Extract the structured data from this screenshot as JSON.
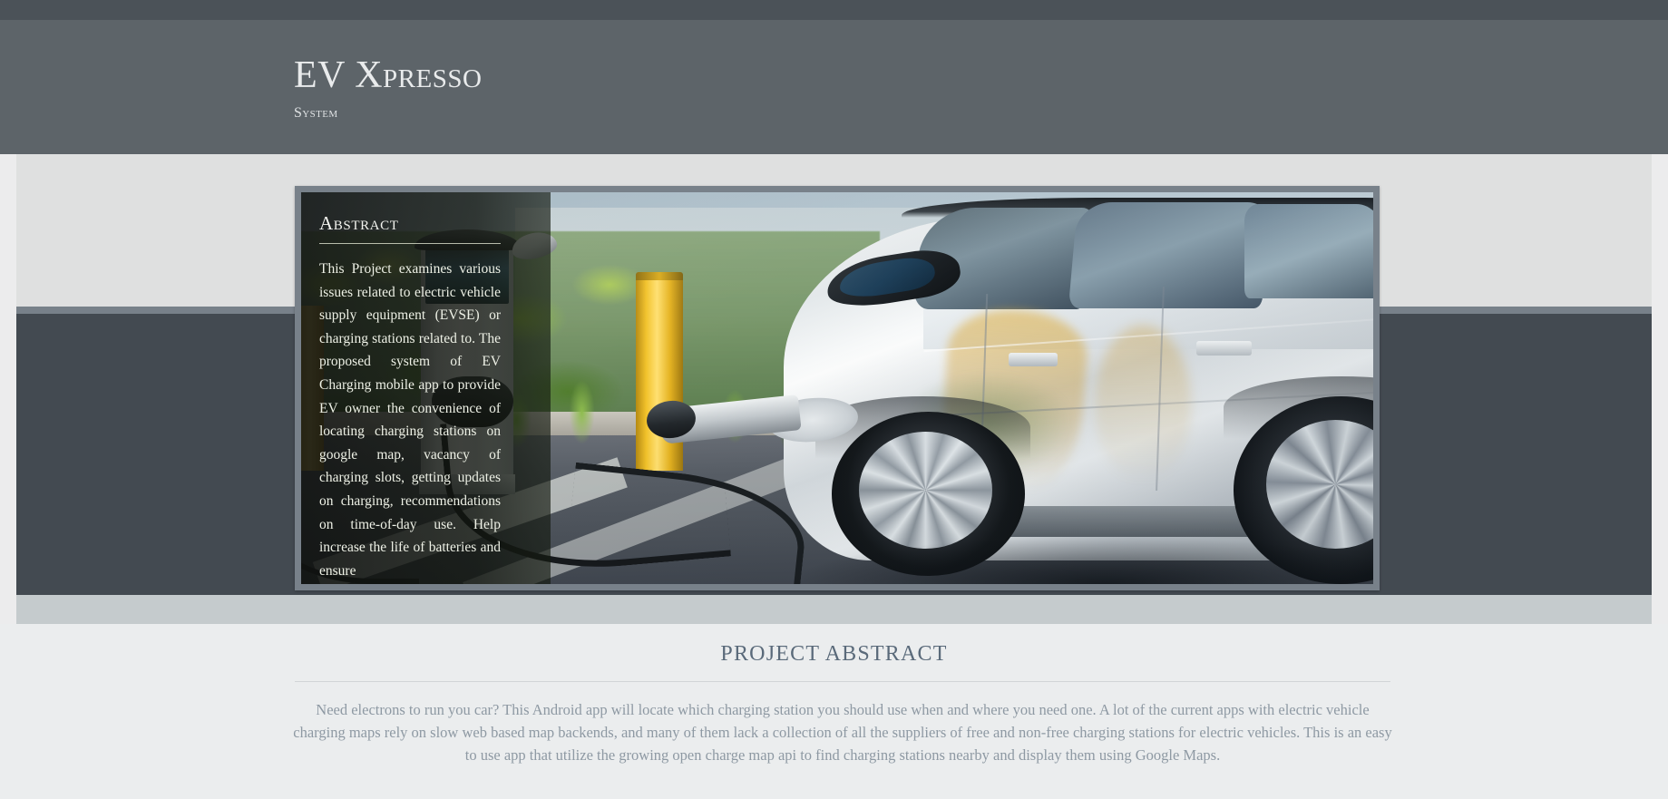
{
  "header": {
    "title": "EV Xpresso",
    "subtitle": "System"
  },
  "hero": {
    "image_alt": "electric-vehicle-charging-station-photo",
    "overlay": {
      "heading": "Abstract",
      "body": "This Project examines various issues related to electric vehicle supply equipment (EVSE) or charging stations related to. The proposed system of EV Charging mobile app to provide EV owner the convenience of locating charging stations on google map, vacancy of charging slots, getting updates on charging, recommendations on time-of-day use. Help increase the life of batteries and ensure"
    }
  },
  "project_abstract": {
    "title": "PROJECT ABSTRACT",
    "body": "Need electrons to run you car? This Android app will locate which charging station you should use when and where you need one. A lot of the current apps with electric vehicle charging maps rely on slow web based map backends, and many of them lack a collection of all the suppliers of free and non-free charging stations for electric vehicles. This is an easy to use app that utilize the growing open charge map api to find charging stations nearby and display them using Google Maps."
  },
  "colors": {
    "top_strip": "#4b5258",
    "header_band": "#5d6469",
    "light_band": "#dfe0e0",
    "divider": "#78818a",
    "dark_band": "#434a51",
    "pale_band": "#c5cbcd",
    "bottom_bg": "#ebedee",
    "section_title": "#5a6a7a",
    "section_body": "#8e99a3",
    "frame": "#78818a"
  }
}
